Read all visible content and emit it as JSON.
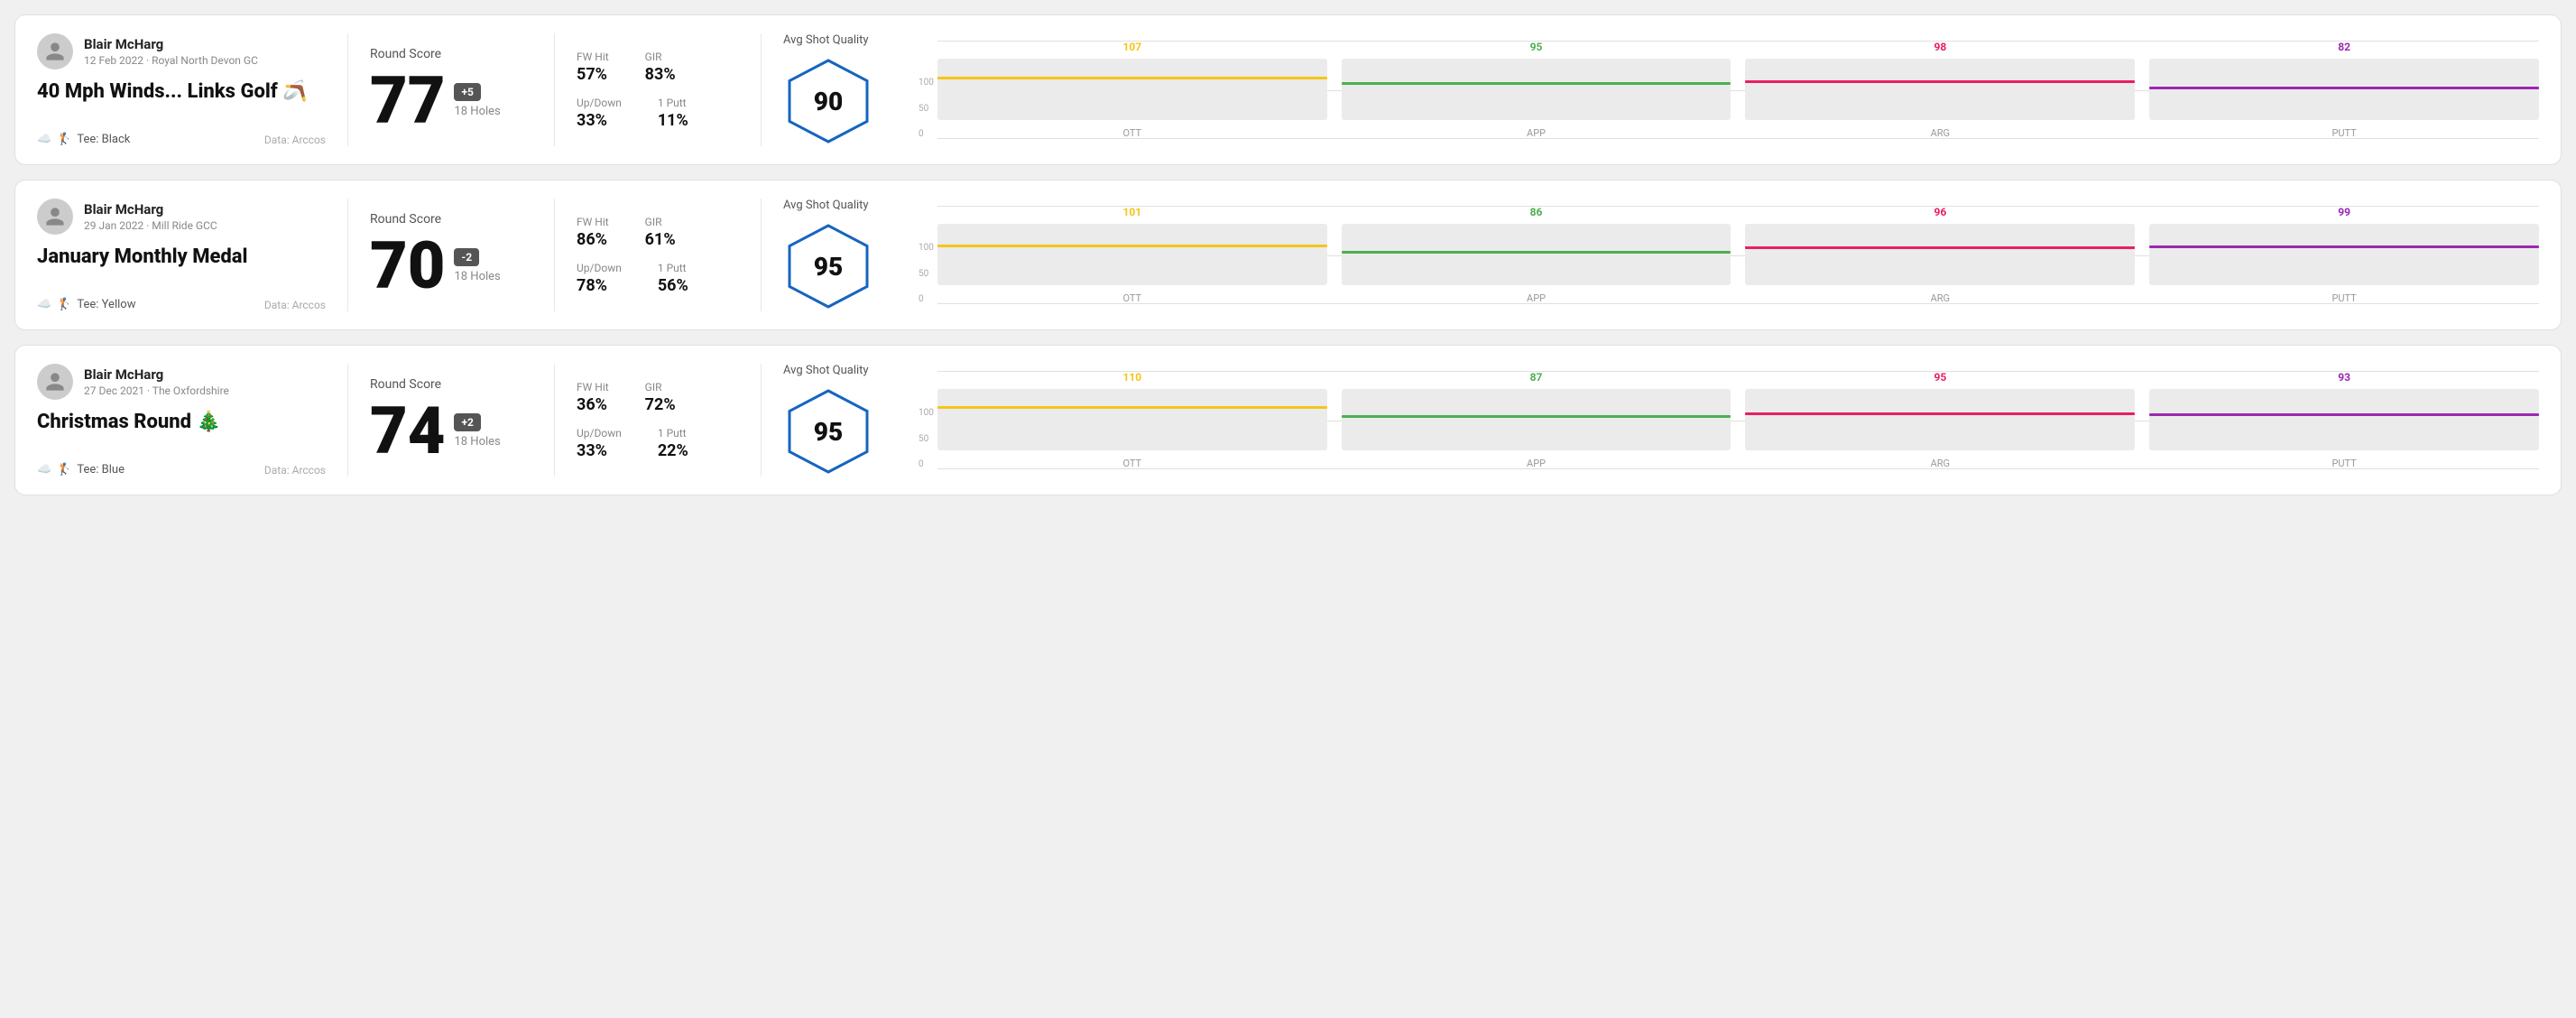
{
  "rounds": [
    {
      "id": "round1",
      "player": {
        "name": "Blair McHarg",
        "date": "12 Feb 2022",
        "course": "Royal North Devon GC",
        "tee": "Black",
        "dataSource": "Arccos"
      },
      "title": "40 Mph Winds... Links Golf 🪃",
      "score": {
        "label": "Round Score",
        "value": "77",
        "badge": "+5",
        "holes": "18 Holes"
      },
      "stats": {
        "fwHit": {
          "label": "FW Hit",
          "value": "57%"
        },
        "gir": {
          "label": "GIR",
          "value": "83%"
        },
        "upDown": {
          "label": "Up/Down",
          "value": "33%"
        },
        "onePutt": {
          "label": "1 Putt",
          "value": "11%"
        }
      },
      "quality": {
        "label": "Avg Shot Quality",
        "value": "90"
      },
      "chart": {
        "bars": [
          {
            "label": "OTT",
            "value": 107,
            "color": "#f5c518",
            "heightPct": 70
          },
          {
            "label": "APP",
            "value": 95,
            "color": "#4caf50",
            "heightPct": 62
          },
          {
            "label": "ARG",
            "value": 98,
            "color": "#e91e63",
            "heightPct": 64
          },
          {
            "label": "PUTT",
            "value": 82,
            "color": "#9c27b0",
            "heightPct": 54
          }
        ]
      }
    },
    {
      "id": "round2",
      "player": {
        "name": "Blair McHarg",
        "date": "29 Jan 2022",
        "course": "Mill Ride GCC",
        "tee": "Yellow",
        "dataSource": "Arccos"
      },
      "title": "January Monthly Medal",
      "score": {
        "label": "Round Score",
        "value": "70",
        "badge": "-2",
        "holes": "18 Holes"
      },
      "stats": {
        "fwHit": {
          "label": "FW Hit",
          "value": "86%"
        },
        "gir": {
          "label": "GIR",
          "value": "61%"
        },
        "upDown": {
          "label": "Up/Down",
          "value": "78%"
        },
        "onePutt": {
          "label": "1 Putt",
          "value": "56%"
        }
      },
      "quality": {
        "label": "Avg Shot Quality",
        "value": "95"
      },
      "chart": {
        "bars": [
          {
            "label": "OTT",
            "value": 101,
            "color": "#f5c518",
            "heightPct": 66
          },
          {
            "label": "APP",
            "value": 86,
            "color": "#4caf50",
            "heightPct": 56
          },
          {
            "label": "ARG",
            "value": 96,
            "color": "#e91e63",
            "heightPct": 63
          },
          {
            "label": "PUTT",
            "value": 99,
            "color": "#9c27b0",
            "heightPct": 65
          }
        ]
      }
    },
    {
      "id": "round3",
      "player": {
        "name": "Blair McHarg",
        "date": "27 Dec 2021",
        "course": "The Oxfordshire",
        "tee": "Blue",
        "dataSource": "Arccos"
      },
      "title": "Christmas Round 🎄",
      "score": {
        "label": "Round Score",
        "value": "74",
        "badge": "+2",
        "holes": "18 Holes"
      },
      "stats": {
        "fwHit": {
          "label": "FW Hit",
          "value": "36%"
        },
        "gir": {
          "label": "GIR",
          "value": "72%"
        },
        "upDown": {
          "label": "Up/Down",
          "value": "33%"
        },
        "onePutt": {
          "label": "1 Putt",
          "value": "22%"
        }
      },
      "quality": {
        "label": "Avg Shot Quality",
        "value": "95"
      },
      "chart": {
        "bars": [
          {
            "label": "OTT",
            "value": 110,
            "color": "#f5c518",
            "heightPct": 72
          },
          {
            "label": "APP",
            "value": 87,
            "color": "#4caf50",
            "heightPct": 57
          },
          {
            "label": "ARG",
            "value": 95,
            "color": "#e91e63",
            "heightPct": 62
          },
          {
            "label": "PUTT",
            "value": 93,
            "color": "#9c27b0",
            "heightPct": 61
          }
        ]
      }
    }
  ],
  "labels": {
    "tee_prefix": "Tee:",
    "data_prefix": "Data:",
    "y_100": "100",
    "y_50": "50",
    "y_0": "0"
  }
}
